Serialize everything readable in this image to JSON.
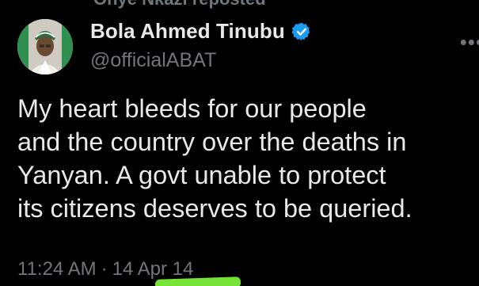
{
  "repost": {
    "label": "Onye Nkazi reposted"
  },
  "author": {
    "display_name": "Bola Ahmed Tinubu",
    "handle": "@officialABAT",
    "verified_icon": "verified-badge-icon",
    "avatar_icon": "profile-photo"
  },
  "more_icon": "ellipsis-icon",
  "tweet": {
    "text": "My heart bleeds for our people\nand the country over the deaths in\nYanyan.  A govt unable to protect\nits citizens deserves to be queried.",
    "time": "11:24 AM",
    "separator": "·",
    "date": "14 Apr 14"
  },
  "colors": {
    "background": "#000000",
    "primary_text": "#e7e9ea",
    "secondary_text": "#71767b",
    "verified_blue": "#1d9bf0",
    "highlight_marker": "#7cf03a"
  }
}
